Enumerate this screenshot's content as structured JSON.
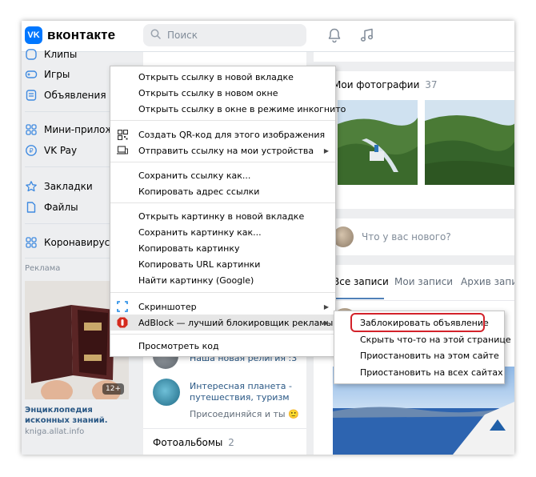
{
  "header": {
    "logo_letters": "VK",
    "logo_text": "вконтакте",
    "search_placeholder": "Поиск"
  },
  "sidebar": {
    "items": [
      {
        "label": "Клипы",
        "icon": "clips-icon"
      },
      {
        "label": "Игры",
        "icon": "gamepad-icon"
      },
      {
        "label": "Объявления",
        "icon": "ads-board-icon"
      },
      {
        "label": "Мини-приложения",
        "icon": "apps-grid-icon"
      },
      {
        "label": "VK Pay",
        "icon": "vkpay-icon"
      },
      {
        "label": "Закладки",
        "icon": "star-icon"
      },
      {
        "label": "Файлы",
        "icon": "file-icon"
      },
      {
        "label": "Коронавирус",
        "icon": "apps-grid-icon"
      }
    ],
    "ad_label": "Реклама",
    "ad_badge": "12+",
    "ad_title": "Энциклопедия исконных знаний.",
    "ad_url": "kniga.allat.info"
  },
  "middle": {
    "communities": [
      {
        "name": "Наша новая религия :3",
        "sub": ""
      },
      {
        "name": "Интересная планета - путешествия, туризм",
        "sub": "Присоединяйся и ты 🙂"
      }
    ],
    "albums_label": "Фотоальбомы",
    "albums_count": "2"
  },
  "right": {
    "photos_title": "Мои фотографии",
    "photos_count": "37",
    "new_post_placeholder": "Что у вас нового?",
    "tabs": [
      "Все записи",
      "Мои записи",
      "Архив записей"
    ]
  },
  "context_menu": {
    "groups": [
      [
        "Открыть ссылку в новой вкладке",
        "Открыть ссылку в новом окне",
        "Открыть ссылку в окне в режиме инкогнито"
      ],
      [
        "Создать QR-код для этого изображения",
        "Отправить ссылку на мои устройства"
      ],
      [
        "Сохранить ссылку как...",
        "Копировать адрес ссылки"
      ],
      [
        "Открыть картинку в новой вкладке",
        "Сохранить картинку как...",
        "Копировать картинку",
        "Копировать URL картинки",
        "Найти картинку (Google)"
      ],
      [
        "Скриншотер",
        "AdBlock — лучший блокировщик рекламы"
      ],
      [
        "Просмотреть код"
      ]
    ]
  },
  "submenu": {
    "items": [
      "Заблокировать объявление",
      "Скрыть что-то на этой странице",
      "Приостановить на этом сайте",
      "Приостановить на всех сайтах"
    ]
  },
  "colors": {
    "vk_blue": "#0077ff",
    "link": "#2a5885",
    "secondary": "#818c99",
    "highlight_ring": "#d3222a",
    "adblock_red": "#d52b1e"
  }
}
